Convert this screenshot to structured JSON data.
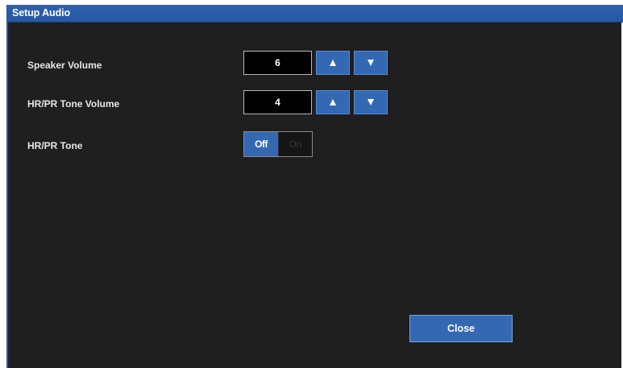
{
  "window": {
    "title": "Setup Audio"
  },
  "settings": {
    "speaker_volume": {
      "label": "Speaker Volume",
      "value": "6"
    },
    "tone_volume": {
      "label": "HR/PR Tone Volume",
      "value": "4"
    },
    "tone": {
      "label": "HR/PR Tone",
      "off_label": "Off",
      "on_label": "On",
      "selected": "Off"
    }
  },
  "buttons": {
    "close_label": "Close"
  },
  "icons": {
    "increase": "arrow-up-icon",
    "decrease": "arrow-down-icon"
  },
  "colors": {
    "accent": "#3568b3",
    "background": "#1f1f1f",
    "titlebar": "#2f62ad"
  }
}
